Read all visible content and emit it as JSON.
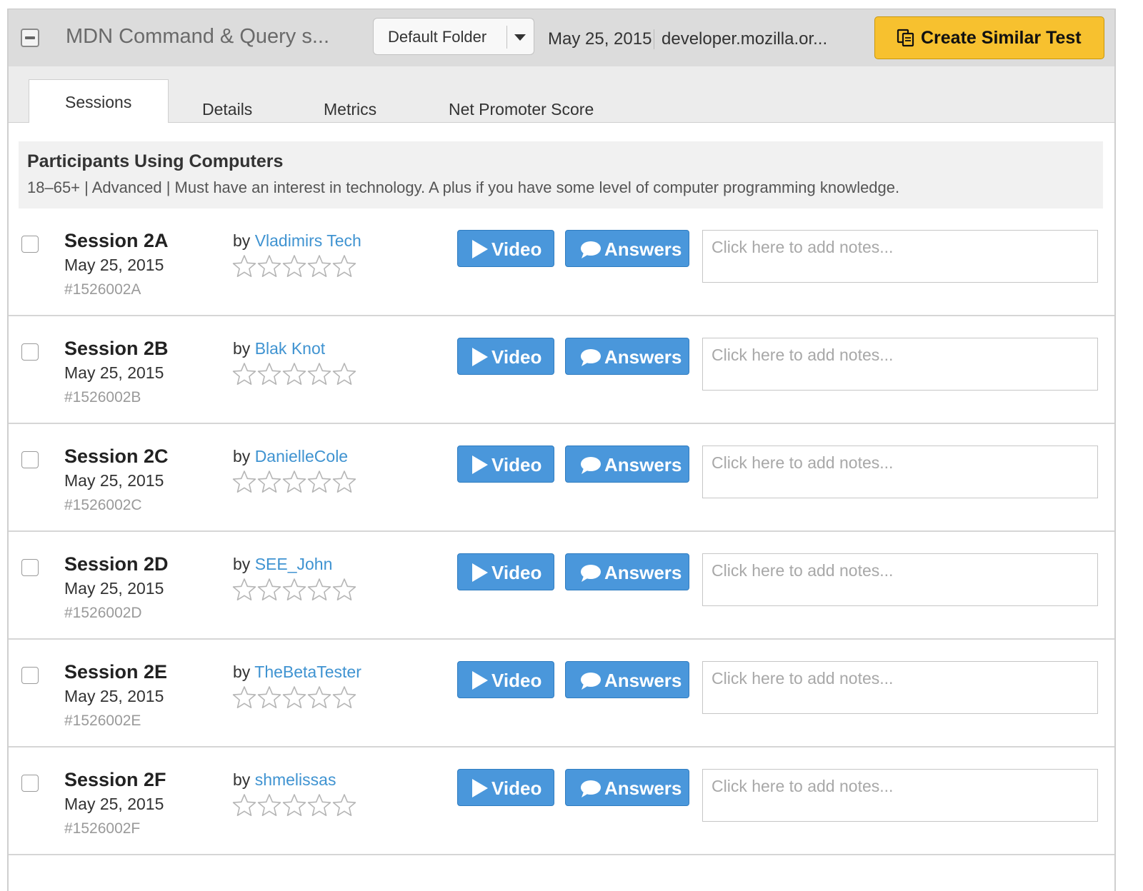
{
  "header": {
    "title": "MDN Command & Query s...",
    "folder": "Default Folder",
    "date": "May 25, 2015",
    "url": "developer.mozilla.or...",
    "create_label": "Create Similar Test",
    "accent_color": "#f7c12f"
  },
  "tabs": [
    {
      "label": "Sessions",
      "active": true
    },
    {
      "label": "Details",
      "active": false
    },
    {
      "label": "Metrics",
      "active": false
    },
    {
      "label": "Net Promoter Score",
      "active": false
    }
  ],
  "participants": {
    "title": "Participants Using Computers",
    "description": "18–65+ | Advanced | Must have an interest in technology. A plus if you have some level of computer programming knowledge."
  },
  "session_labels": {
    "by": "by",
    "video": "Video",
    "answers": "Answers",
    "notes_placeholder": "Click here to add notes..."
  },
  "sessions": [
    {
      "title": "Session 2A",
      "date": "May 25, 2015",
      "id": "#1526002A",
      "tester": "Vladimirs Tech",
      "rating": 0
    },
    {
      "title": "Session 2B",
      "date": "May 25, 2015",
      "id": "#1526002B",
      "tester": "Blak Knot",
      "rating": 0
    },
    {
      "title": "Session 2C",
      "date": "May 25, 2015",
      "id": "#1526002C",
      "tester": "DanielleCole",
      "rating": 0
    },
    {
      "title": "Session 2D",
      "date": "May 25, 2015",
      "id": "#1526002D",
      "tester": "SEE_John",
      "rating": 0
    },
    {
      "title": "Session 2E",
      "date": "May 25, 2015",
      "id": "#1526002E",
      "tester": "TheBetaTester",
      "rating": 0
    },
    {
      "title": "Session 2F",
      "date": "May 25, 2015",
      "id": "#1526002F",
      "tester": "shmelissas",
      "rating": 0
    }
  ],
  "icons": {
    "collapse": "minus-square-icon",
    "folder_caret": "caret-down-icon",
    "create": "copy-icon",
    "video": "play-icon",
    "answers": "chat-bubble-icon",
    "star": "star-outline-icon"
  },
  "colors": {
    "link": "#3f93d1",
    "button_blue": "#4a97db",
    "star_outline": "#b5b5b5"
  }
}
